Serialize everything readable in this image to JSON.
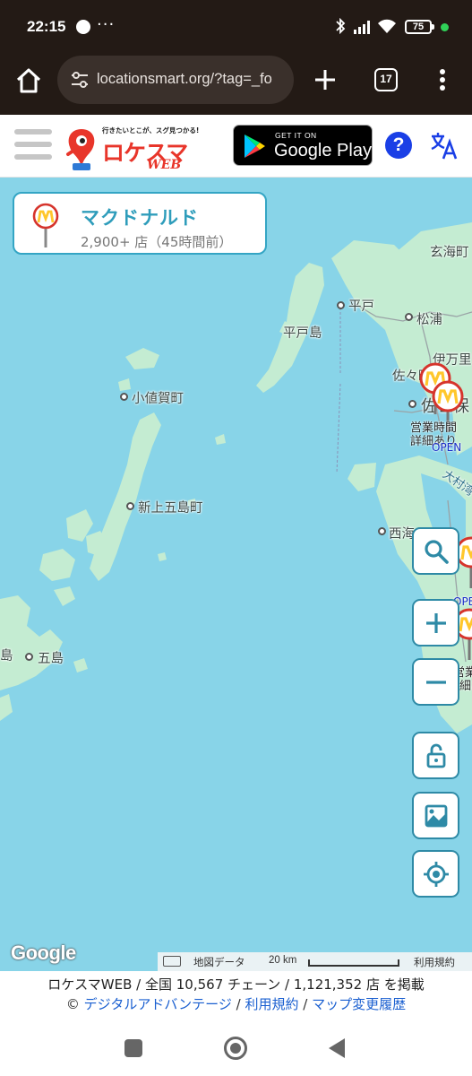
{
  "status_bar": {
    "time": "22:15",
    "more_indicator": "···",
    "battery_level": "75",
    "icons": [
      "line-icon",
      "bluetooth-icon",
      "signal-icon",
      "wifi-icon",
      "battery-icon",
      "charging-dot-icon"
    ]
  },
  "browser": {
    "url": "locationsmart.org/?tag=_fo",
    "tab_count": "17",
    "icons": [
      "home-icon",
      "site-settings-icon",
      "new-tab-icon",
      "menu-icon"
    ]
  },
  "site_header": {
    "logo_tagline": "行きたいとこが、スグ見つかる!",
    "logo_main": "ロケスマ",
    "logo_web": "WEB",
    "gplay_small": "GET IT ON",
    "gplay_big": "Google Play",
    "help_label": "?",
    "icons": [
      "hamburger-icon",
      "google-play-icon",
      "help-icon",
      "translate-icon"
    ]
  },
  "store_card": {
    "name": "マクドナルド",
    "count_text": "2,900+ 店（45時間前）"
  },
  "map": {
    "places": [
      {
        "name": "玄海町"
      },
      {
        "name": "平戸"
      },
      {
        "name": "松浦"
      },
      {
        "name": "平戸島"
      },
      {
        "name": "伊万里"
      },
      {
        "name": "佐々町"
      },
      {
        "name": "佐世保"
      },
      {
        "name": "小値賀町"
      },
      {
        "name": "新上五島町"
      },
      {
        "name": "西海"
      },
      {
        "name": "大村湾"
      },
      {
        "name": "五島"
      },
      {
        "name": "島"
      }
    ],
    "pin_labels": {
      "label1": "営業時間",
      "label2": "詳細あり",
      "open": "OPEN",
      "partial_open": "OPE",
      "partial1": "営業",
      "partial2": "詳細あ"
    },
    "controls": [
      "search-button",
      "zoom-in-button",
      "zoom-out-button",
      "lock-button",
      "layer-button",
      "locate-button"
    ],
    "google_logo": "Google",
    "attribution_data": "地図データ",
    "scale_label": "20 km",
    "terms": "利用規約"
  },
  "footer": {
    "line1": "ロケスマWEB / 全国 10,567 チェーン / 1,121,352 店 を掲載",
    "copyright": "©",
    "link1": "デジタルアドバンテージ",
    "sep": "/",
    "link2": "利用規約",
    "link3": "マップ変更履歴"
  },
  "colors": {
    "sea": "#88d4e8",
    "land": "#c4ecd2",
    "accent": "#2f9dbb",
    "mcd_red": "#d6342c",
    "mcd_yellow": "#ffc72c"
  }
}
